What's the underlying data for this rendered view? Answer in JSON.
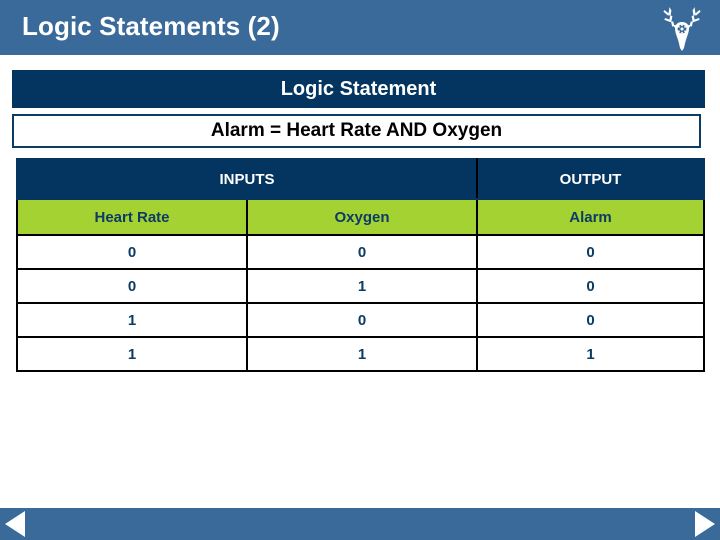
{
  "header": {
    "title": "Logic Statements (2)",
    "logo_name": "stag-head-logo",
    "background_color": "#3a6a9a"
  },
  "banner": {
    "label": "Logic Statement",
    "background_color": "#033560"
  },
  "statement": {
    "text": "Alarm = Heart Rate AND Oxygen",
    "border_color": "#0c3c63"
  },
  "truth_table": {
    "group_headers": [
      {
        "label": "INPUTS",
        "span": 2
      },
      {
        "label": "OUTPUT",
        "span": 1
      }
    ],
    "column_headers": [
      "Heart Rate",
      "Oxygen",
      "Alarm"
    ],
    "header_background_color": "#a4d233",
    "header_text_color": "#0c3c63",
    "rows": [
      [
        "0",
        "0",
        "0"
      ],
      [
        "0",
        "1",
        "0"
      ],
      [
        "1",
        "0",
        "0"
      ],
      [
        "1",
        "1",
        "1"
      ]
    ]
  },
  "nav": {
    "prev_label": "Previous slide",
    "next_label": "Next slide",
    "background_color": "#3a6a9a"
  }
}
